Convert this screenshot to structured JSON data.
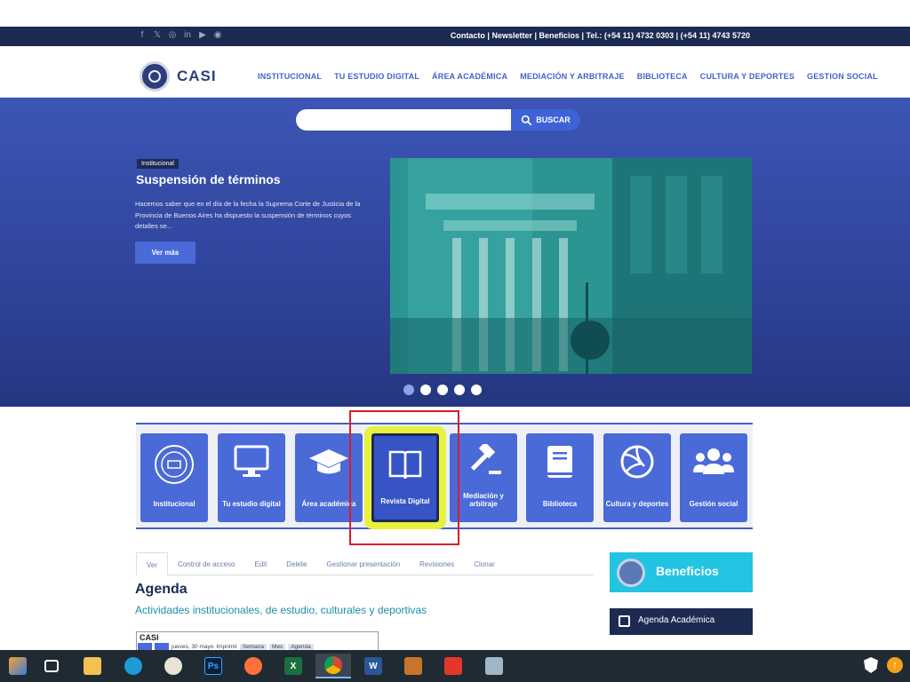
{
  "topbar": {
    "contact_text": "Contacto | Newsletter  | Beneficios | Tel.: (+54 11) 4732 0303 | (+54 11) 4743 5720",
    "social_icons": [
      "facebook-icon",
      "x-icon",
      "instagram-icon",
      "linkedin-icon",
      "youtube-icon",
      "rss-icon"
    ],
    "social_glyphs": [
      "f",
      "𝕏",
      "◎",
      "in",
      "▶",
      "◉"
    ]
  },
  "header": {
    "logo_text": "CASI",
    "nav": [
      "INSTITUCIONAL",
      "TU ESTUDIO DIGITAL",
      "ÁREA ACADÉMICA",
      "MEDIACIÓN Y ARBITRAJE",
      "BIBLIOTECA",
      "CULTURA Y DEPORTES",
      "GESTION SOCIAL"
    ]
  },
  "search": {
    "placeholder": "",
    "button_label": "BUSCAR"
  },
  "slide": {
    "badge": "Institucional",
    "title": "Suspensión de términos",
    "text": "Hacemos saber que en el día de la fecha la Suprema Corte de Justicia de la Provincia de Buenos Aires ha dispuesto la suspensión de términos cuyos detalles se...",
    "button": "Ver más",
    "dots": 5,
    "active_dot": 0
  },
  "tiles": [
    {
      "label": "Institucional",
      "icon": "seal-icon"
    },
    {
      "label": "Tu estudio digital",
      "icon": "monitor-icon"
    },
    {
      "label": "Área académica",
      "icon": "graduation-cap-icon"
    },
    {
      "label": "Revista Digital",
      "icon": "open-book-icon",
      "selected": true
    },
    {
      "label": "Mediación y arbitraje",
      "icon": "gavel-icon"
    },
    {
      "label": "Biblioteca",
      "icon": "book-icon"
    },
    {
      "label": "Cultura y deportes",
      "icon": "volleyball-icon"
    },
    {
      "label": "Gestión social",
      "icon": "users-icon"
    }
  ],
  "tabs": [
    "Ver",
    "Control de acceso",
    "Edit",
    "Delete",
    "Gestionar presentación",
    "Revisiones",
    "Clonar"
  ],
  "active_tab": 0,
  "agenda": {
    "title": "Agenda",
    "subtitle": "Actividades institucionales, de estudio, culturales y deportivas",
    "embed_title": "CASI",
    "embed_date": "jueves, 30 mayo",
    "embed_print": "Imprimir",
    "embed_views": [
      "Semana",
      "Mes",
      "Agenda"
    ]
  },
  "sidebar": {
    "beneficios": "Beneficios",
    "agenda_academica": "Agenda Académica"
  },
  "taskbar": {
    "apps": [
      "start-icon",
      "task-view-icon",
      "file-explorer-icon",
      "edge-icon",
      "paint-icon",
      "photoshop-icon",
      "firefox-icon",
      "excel-icon",
      "chrome-icon",
      "word-icon",
      "calculator-icon",
      "acrobat-icon",
      "camera-icon"
    ],
    "app_letters": [
      "",
      "",
      "",
      "",
      "",
      "Ps",
      "",
      "X",
      "",
      "W",
      "",
      "",
      ""
    ],
    "active_app": "chrome-icon"
  },
  "colors": {
    "navy": "#1d2a52",
    "brand_blue": "#4a6ad8",
    "cyan": "#22c4e2",
    "highlight": "#e8f040",
    "annotation_red": "#d81f26"
  }
}
